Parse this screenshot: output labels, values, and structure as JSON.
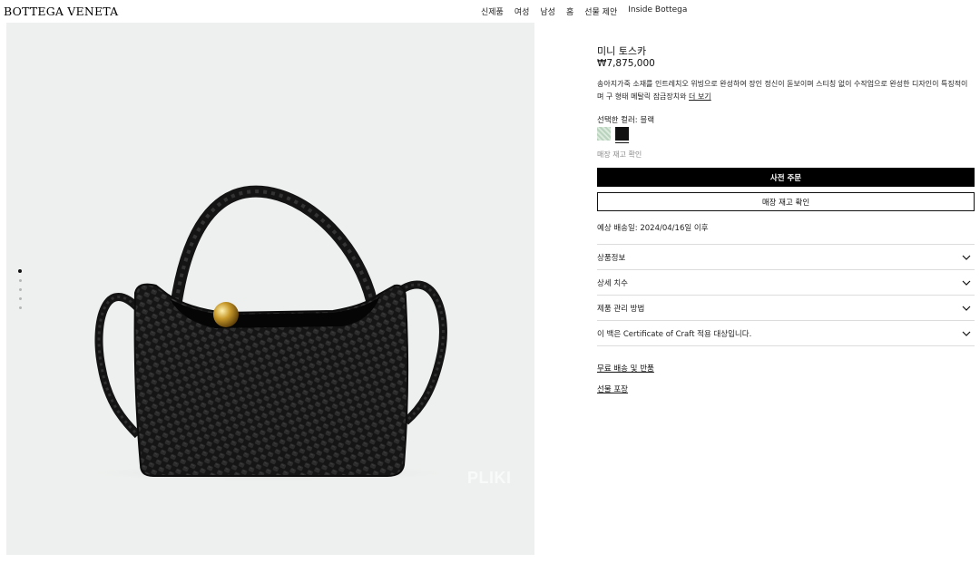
{
  "header": {
    "logo": "BOTTEGA VENETA",
    "nav": [
      "신제품",
      "여성",
      "남성",
      "홈",
      "선물 제안",
      "Inside Bottega"
    ]
  },
  "gallery": {
    "watermark": "PLIKI",
    "dot_count": 5,
    "active_dot": 0
  },
  "product": {
    "title": "미니 토스카",
    "price": "₩7,875,000",
    "description": "송아지가죽 소재를 인트레치오 위빙으로 완성하여 장인 정신이 돋보이며 스티칭 없이 수작업으로 완성한 디자인이 특징적이며 구 형태 메탈릭 잠금장치와",
    "more_link": "더 보기",
    "color_label": "선택한 컬러: 블랙",
    "swatches": [
      {
        "name": "green",
        "color": "#c8dccb",
        "selected": false
      },
      {
        "name": "black",
        "color": "#111111",
        "selected": true
      }
    ],
    "stock_note": "매장 재고 확인",
    "preorder_button": "사전 주문",
    "stock_button": "매장 재고 확인",
    "shipping": "예상 배송일: 2024/04/16일 이후",
    "accordion": [
      "상품정보",
      "상세 치수",
      "제품 관리 방법",
      "이 백은 Certificate of Craft 적용 대상입니다."
    ],
    "links": {
      "free_shipping": "무료 배송 및 반품",
      "gift_wrap": "선물 포장"
    }
  }
}
